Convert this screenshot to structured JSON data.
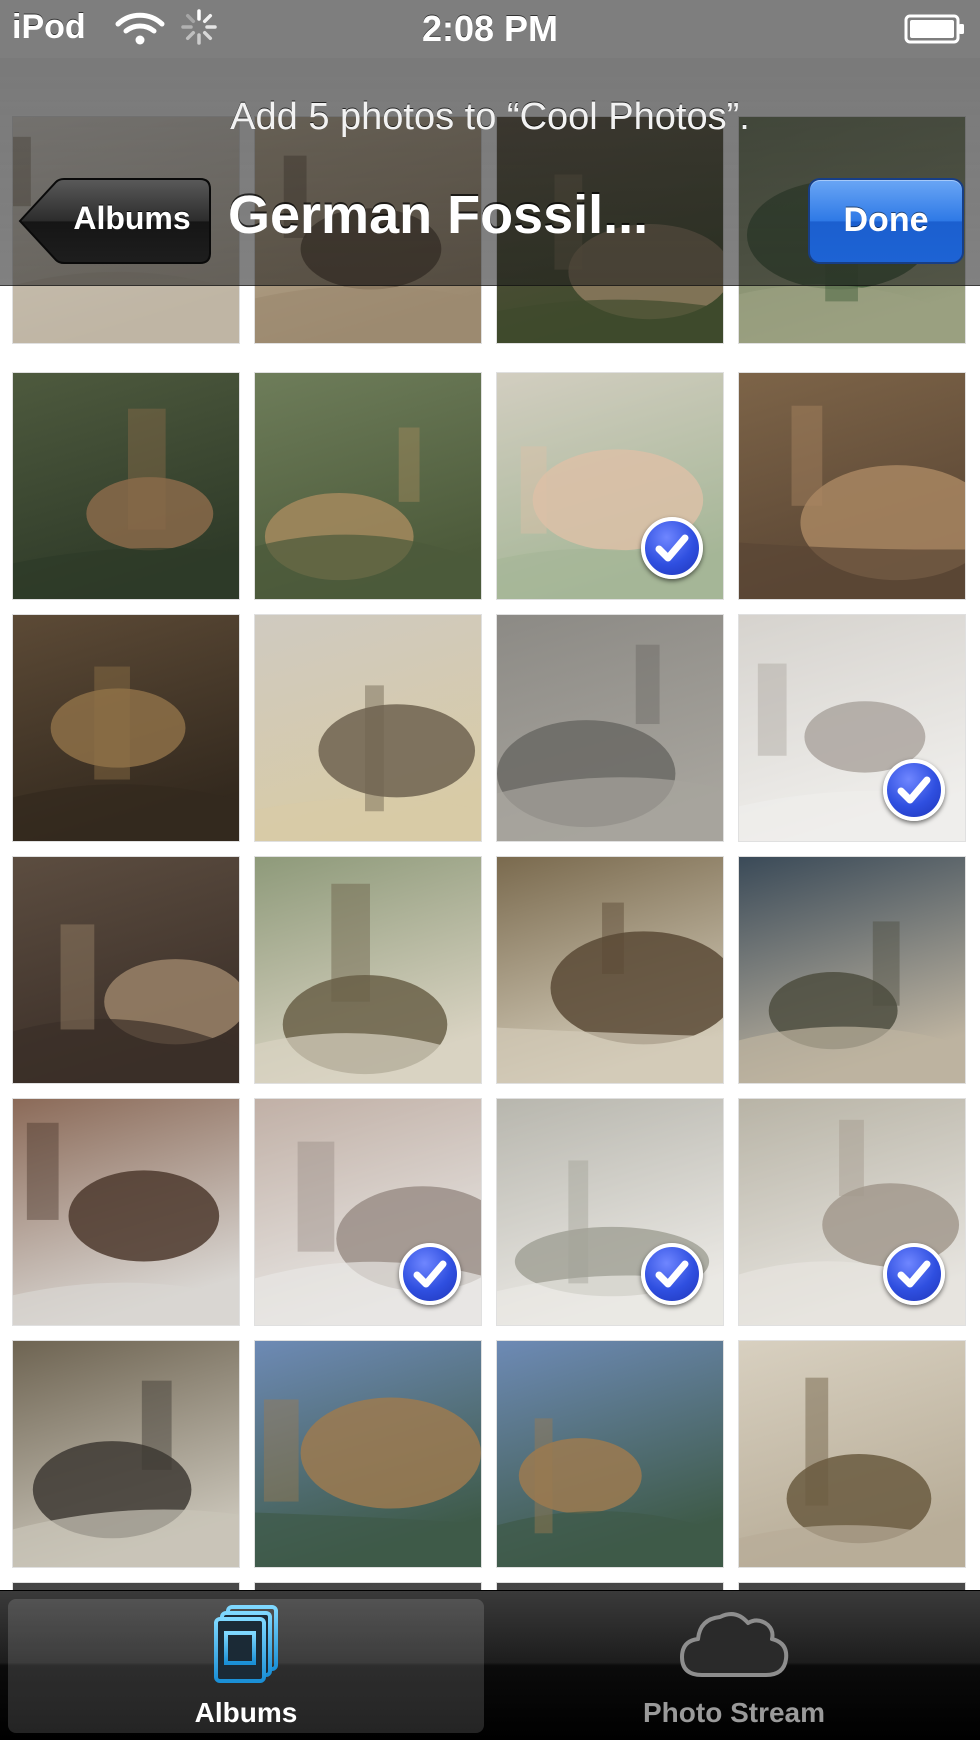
{
  "status_bar": {
    "carrier": "iPod",
    "time": "2:08 PM",
    "icons": [
      "wifi-icon",
      "activity-icon",
      "battery-icon"
    ]
  },
  "nav_bar": {
    "prompt": "Add 5 photos to “Cool Photos”.",
    "back_label": "Albums",
    "title": "German Fossil...",
    "done_label": "Done"
  },
  "photos": [
    {
      "row": 0,
      "col": 0,
      "selected": false,
      "colors": [
        "#e9e4dc",
        "#7a6a55",
        "#bfb5a4"
      ]
    },
    {
      "row": 0,
      "col": 1,
      "selected": false,
      "colors": [
        "#c8b89d",
        "#5a4a38",
        "#9c8a70"
      ]
    },
    {
      "row": 0,
      "col": 2,
      "selected": false,
      "colors": [
        "#5d5340",
        "#8c7a5e",
        "#3e4a2c"
      ]
    },
    {
      "row": 0,
      "col": 3,
      "selected": false,
      "colors": [
        "#6d7a5a",
        "#3f5a38",
        "#9aa080"
      ]
    },
    {
      "row": 1,
      "col": 0,
      "selected": false,
      "colors": [
        "#4e5a3e",
        "#8a6a4a",
        "#2e3a28"
      ]
    },
    {
      "row": 1,
      "col": 1,
      "selected": false,
      "colors": [
        "#6e7d5a",
        "#a58a5e",
        "#4c5a3a"
      ]
    },
    {
      "row": 1,
      "col": 2,
      "selected": true,
      "colors": [
        "#b7b09a",
        "#c79a72",
        "#6f8a58"
      ]
    },
    {
      "row": 1,
      "col": 3,
      "selected": false,
      "colors": [
        "#7d6448",
        "#a88662",
        "#5a4634"
      ]
    },
    {
      "row": 2,
      "col": 0,
      "selected": false,
      "colors": [
        "#5c4a36",
        "#8d7048",
        "#33291e"
      ]
    },
    {
      "row": 2,
      "col": 1,
      "selected": false,
      "colors": [
        "#cfcac0",
        "#6e6350",
        "#d8cba6"
      ]
    },
    {
      "row": 2,
      "col": 2,
      "selected": false,
      "colors": [
        "#8c8a85",
        "#6a6864",
        "#a7a49d"
      ]
    },
    {
      "row": 2,
      "col": 3,
      "selected": true,
      "colors": [
        "#bdb8b0",
        "#7a7066",
        "#e6e4e0"
      ]
    },
    {
      "row": 3,
      "col": 0,
      "selected": false,
      "colors": [
        "#5c4d40",
        "#9a8268",
        "#3b2f28"
      ]
    },
    {
      "row": 3,
      "col": 1,
      "selected": false,
      "colors": [
        "#8e9a7a",
        "#6a6048",
        "#d9d3c2"
      ]
    },
    {
      "row": 3,
      "col": 2,
      "selected": false,
      "colors": [
        "#7a6a4e",
        "#5a4a36",
        "#d3cbb8"
      ]
    },
    {
      "row": 3,
      "col": 3,
      "selected": false,
      "colors": [
        "#3a4a58",
        "#4e4e40",
        "#bdb3a0"
      ]
    },
    {
      "row": 4,
      "col": 0,
      "selected": false,
      "colors": [
        "#8b6a58",
        "#4e3a2e",
        "#d9d6d2"
      ]
    },
    {
      "row": 4,
      "col": 1,
      "selected": true,
      "colors": [
        "#9b8070",
        "#5e4a3e",
        "#dad7d3"
      ]
    },
    {
      "row": 4,
      "col": 2,
      "selected": true,
      "colors": [
        "#8c8a7c",
        "#6a6a58",
        "#dedbd4"
      ]
    },
    {
      "row": 4,
      "col": 3,
      "selected": true,
      "colors": [
        "#8d8670",
        "#6a5a48",
        "#d8d4cc"
      ]
    },
    {
      "row": 5,
      "col": 0,
      "selected": false,
      "colors": [
        "#6e6452",
        "#3e3a34",
        "#c9c4b8"
      ]
    },
    {
      "row": 5,
      "col": 1,
      "selected": false,
      "colors": [
        "#6d8ab5",
        "#9c7a50",
        "#3e5a48"
      ]
    },
    {
      "row": 5,
      "col": 2,
      "selected": false,
      "colors": [
        "#6d8ab5",
        "#9c7a50",
        "#3e5a48"
      ]
    },
    {
      "row": 5,
      "col": 3,
      "selected": false,
      "colors": [
        "#d8d0c0",
        "#6a5a40",
        "#b8ad98"
      ]
    },
    {
      "row": 6,
      "col": 0,
      "selected": false,
      "colors": [
        "#444444",
        "#666666",
        "#555555"
      ]
    },
    {
      "row": 6,
      "col": 1,
      "selected": false,
      "colors": [
        "#444444",
        "#666666",
        "#555555"
      ]
    },
    {
      "row": 6,
      "col": 2,
      "selected": false,
      "colors": [
        "#444444",
        "#666666",
        "#555555"
      ]
    },
    {
      "row": 6,
      "col": 3,
      "selected": false,
      "colors": [
        "#444444",
        "#666666",
        "#555555"
      ]
    }
  ],
  "selection_check_icon": "checkmark-circle-icon",
  "tab_bar": {
    "tabs": [
      {
        "label": "Albums",
        "icon": "albums-icon",
        "active": true
      },
      {
        "label": "Photo Stream",
        "icon": "cloud-icon",
        "active": false
      }
    ]
  },
  "colors": {
    "done_button": "#2e79e6",
    "check_badge": "#2f4fe0",
    "active_tab_icon": "#2aa8e0"
  }
}
